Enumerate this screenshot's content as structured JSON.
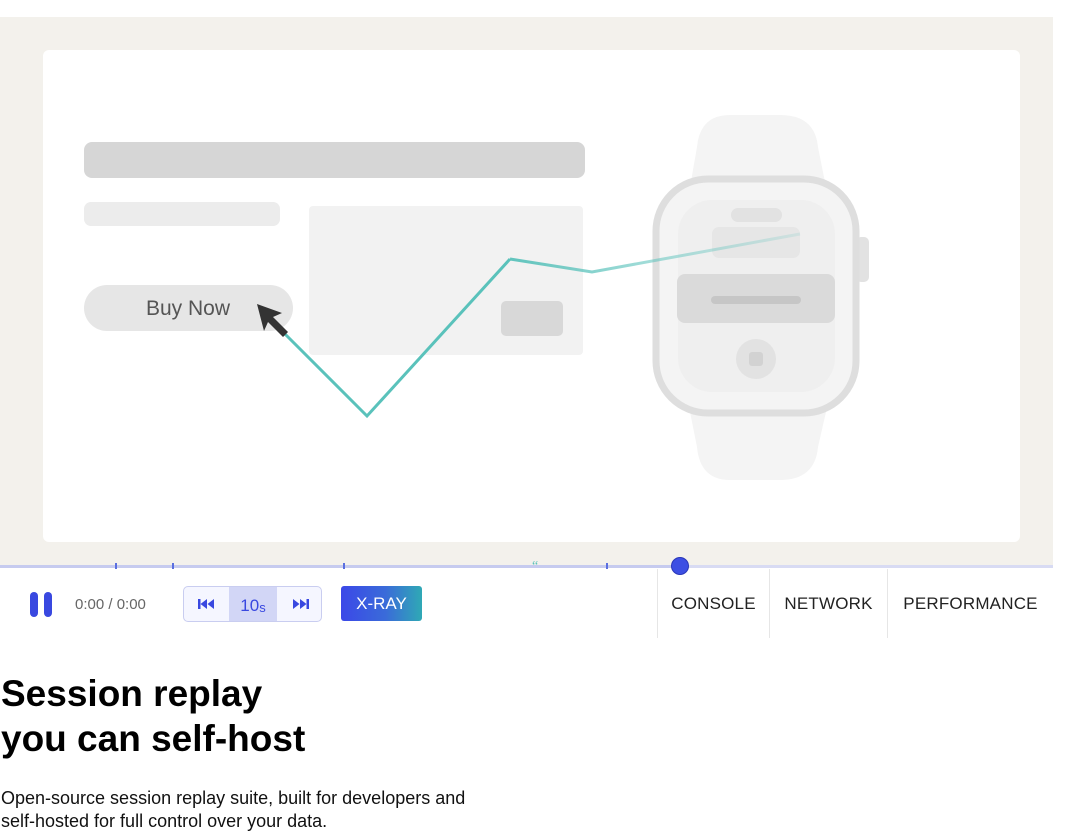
{
  "player": {
    "demo_button_label": "Buy Now",
    "time_readout": "0:00 / 0:00",
    "skip_interval": "10",
    "skip_unit": "s",
    "xray_label": "X-RAY",
    "tabs": [
      "CONSOLE",
      "NETWORK",
      "PERFORMANCE"
    ],
    "icons": {
      "pause": "pause-icon",
      "skip_back": "rewind-icon",
      "skip_forward": "fast-forward-icon"
    },
    "colors": {
      "accent": "#3948e0",
      "cursor_trail": "#5ac2bb",
      "stage_background": "#f3f1ec"
    }
  },
  "hero": {
    "title_line1": "Session replay",
    "title_line2": "you can self-host",
    "subtitle_line1": "Open-source session replay suite, built for developers and",
    "subtitle_line2": "self-hosted for full control over your data."
  }
}
